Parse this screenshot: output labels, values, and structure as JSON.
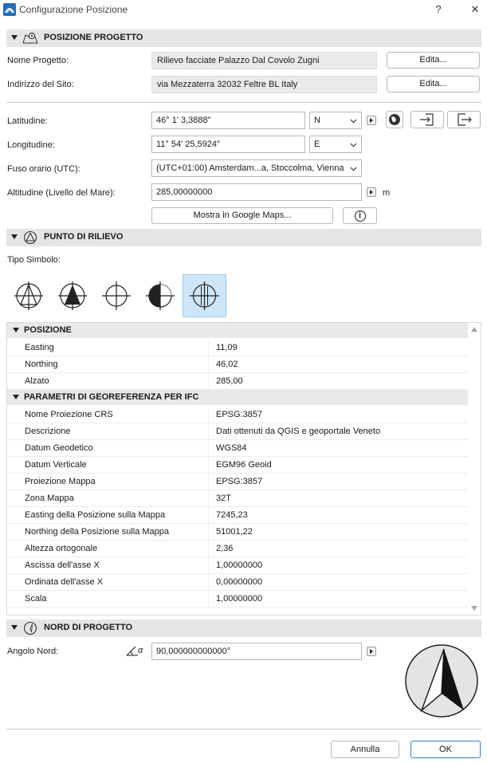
{
  "window": {
    "title": "Configurazione Posizione",
    "help_label": "?",
    "close_label": "✕",
    "app_icon": "archicad-icon"
  },
  "project_position": {
    "header": "POSIZIONE PROGETTO",
    "icon": "map-pin-icon",
    "project_name_label": "Nome Progetto:",
    "project_name_value": "Rilievo facciate Palazzo Dal Covolo Zugni",
    "site_address_label": "Indirizzo del Sito:",
    "site_address_value": "via Mezzaterra 32032 Feltre BL Italy",
    "edit_label": "Edita...",
    "latitude_label": "Latitudine:",
    "latitude_value": "46° 1' 3,3888\"",
    "latitude_hemisphere": "N",
    "longitude_label": "Longitudine:",
    "longitude_value": "11° 54' 25,5924\"",
    "longitude_hemisphere": "E",
    "timezone_label": "Fuso orario (UTC):",
    "timezone_value": "(UTC+01:00) Amsterdam...a, Stoccolma, Vienna",
    "altitude_label": "Altitudine (Livello del Mare):",
    "altitude_value": "285,00000000",
    "altitude_unit": "m",
    "google_maps_label": "Mostra in Google Maps...",
    "info_label": "i"
  },
  "survey_point": {
    "header": "PUNTO DI RILIEVO",
    "icon": "survey-triangle-icon",
    "symbol_type_label": "Tipo Simbolo:",
    "symbols": [
      "crosshair-triangle-outline",
      "crosshair-triangle-filled",
      "crosshair-circle",
      "crosshair-half-filled",
      "crosshair-double-circle"
    ],
    "selected_symbol_index": 4
  },
  "properties": {
    "groups": [
      {
        "label": "POSIZIONE",
        "rows": [
          {
            "k": "Easting",
            "v": "11,09"
          },
          {
            "k": "Northing",
            "v": "46,02"
          },
          {
            "k": "Alzato",
            "v": "285,00"
          }
        ]
      },
      {
        "label": "PARAMETRI DI GEOREFERENZA PER IFC",
        "rows": [
          {
            "k": "Nome Proiezione CRS",
            "v": "EPSG:3857"
          },
          {
            "k": "Descrizione",
            "v": "Dati ottenuti da  QGIS e geoportale Veneto"
          },
          {
            "k": "Datum Geodetico",
            "v": "WGS84"
          },
          {
            "k": "Datum Verticale",
            "v": "EGM96 Geoid"
          },
          {
            "k": "Proiezione Mappa",
            "v": "EPSG:3857"
          },
          {
            "k": "Zona Mappa",
            "v": "32T"
          },
          {
            "k": "Easting della Posizione sulla Mappa",
            "v": "7245,23"
          },
          {
            "k": "Northing della Posizione sulla Mappa",
            "v": "51001,22"
          },
          {
            "k": "Altezza ortogonale",
            "v": "2,36"
          },
          {
            "k": "Ascissa dell'asse X",
            "v": "1,00000000"
          },
          {
            "k": "Ordinata dell'asse X",
            "v": "0,00000000"
          },
          {
            "k": "Scala",
            "v": "1,00000000"
          }
        ]
      }
    ]
  },
  "project_north": {
    "header": "NORD DI PROGETTO",
    "icon": "compass-icon",
    "angle_label": "Angolo Nord:",
    "angle_value": "90,000000000000°",
    "angle_icon_text": "α"
  },
  "footer": {
    "cancel_label": "Annulla",
    "ok_label": "OK"
  },
  "colors": {
    "section_bg": "#e5e5e5",
    "selected_symbol_bg": "#cde6f7",
    "ok_border": "#2a7fd4"
  }
}
